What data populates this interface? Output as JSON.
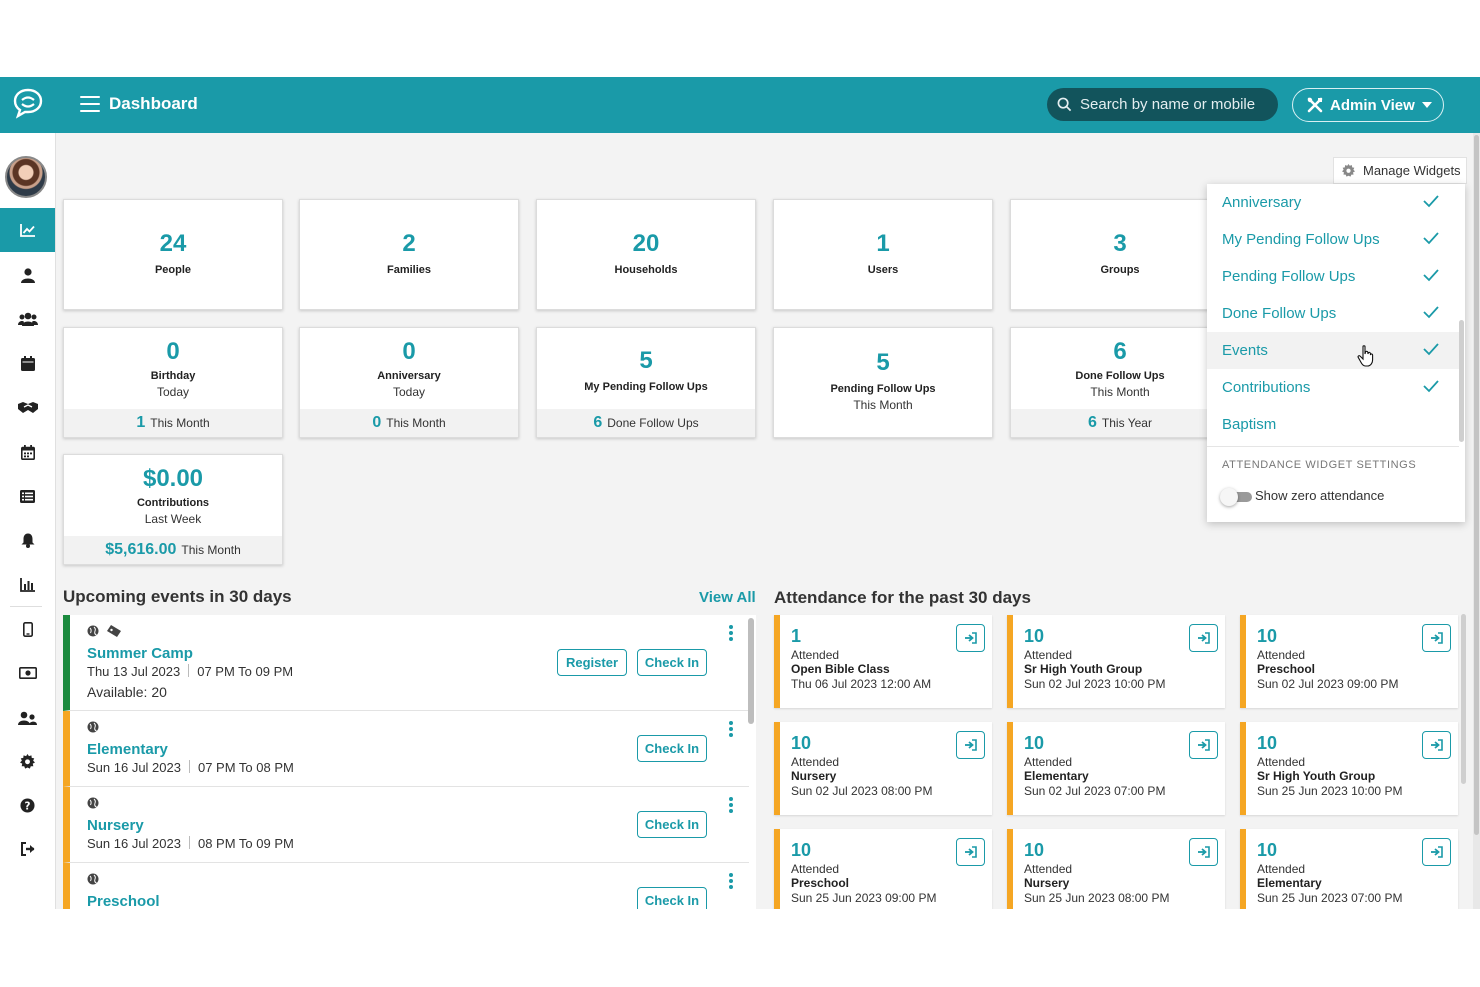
{
  "header": {
    "title": "Dashboard",
    "search_placeholder": "Search by name or mobile",
    "admin_view_label": "Admin View"
  },
  "colors": {
    "brand": "#1a9aa8",
    "accent": "#f5a623",
    "event_active": "#1b8a3e"
  },
  "sidebar": {
    "items": [
      {
        "name": "dashboard",
        "icon": "chart-icon",
        "active": true
      },
      {
        "name": "people",
        "icon": "person-icon"
      },
      {
        "name": "groups",
        "icon": "users-icon"
      },
      {
        "name": "events",
        "icon": "calendar-icon"
      },
      {
        "name": "follow-ups",
        "icon": "handshake-icon"
      },
      {
        "name": "schedule",
        "icon": "calendar-grid-icon"
      },
      {
        "name": "lists",
        "icon": "list-icon"
      },
      {
        "name": "notifications",
        "icon": "bell-icon"
      },
      {
        "name": "reports",
        "icon": "bar-chart-icon"
      },
      {
        "name": "mobile",
        "icon": "mobile-icon"
      },
      {
        "name": "contributions",
        "icon": "money-icon"
      },
      {
        "name": "users",
        "icon": "user-group-icon"
      },
      {
        "name": "settings",
        "icon": "gear-icon"
      },
      {
        "name": "help",
        "icon": "question-icon"
      },
      {
        "name": "logout",
        "icon": "logout-icon"
      }
    ]
  },
  "widgets": {
    "row1": [
      {
        "value": "24",
        "label": "People"
      },
      {
        "value": "2",
        "label": "Families"
      },
      {
        "value": "20",
        "label": "Households"
      },
      {
        "value": "1",
        "label": "Users"
      },
      {
        "value": "3",
        "label": "Groups"
      }
    ],
    "birthday": {
      "value": "0",
      "label": "Birthday",
      "sub": "Today",
      "foot_value": "1",
      "foot_label": "This Month"
    },
    "anniversary": {
      "value": "0",
      "label": "Anniversary",
      "sub": "Today",
      "foot_value": "0",
      "foot_label": "This Month"
    },
    "my_pending": {
      "value": "5",
      "label": "My Pending Follow Ups",
      "foot_value": "6",
      "foot_label": "Done Follow Ups"
    },
    "pending": {
      "value": "5",
      "label": "Pending Follow Ups",
      "sub": "This Month"
    },
    "done": {
      "value": "6",
      "label": "Done Follow Ups",
      "sub": "This Month",
      "foot_value": "6",
      "foot_label": "This Year"
    },
    "contributions": {
      "value": "$0.00",
      "label": "Contributions",
      "sub": "Last Week",
      "foot_value": "$5,616.00",
      "foot_label": "This Month"
    }
  },
  "manage_widgets": {
    "button_label": "Manage Widgets",
    "items": [
      {
        "label": "Anniversary",
        "checked": true
      },
      {
        "label": "My Pending Follow Ups",
        "checked": true
      },
      {
        "label": "Pending Follow Ups",
        "checked": true
      },
      {
        "label": "Done Follow Ups",
        "checked": true
      },
      {
        "label": "Events",
        "checked": true
      },
      {
        "label": "Contributions",
        "checked": true
      },
      {
        "label": "Baptism",
        "checked": false
      }
    ],
    "section_title": "ATTENDANCE WIDGET SETTINGS",
    "toggle_label": "Show zero attendance",
    "toggle_on": false
  },
  "events": {
    "title": "Upcoming events in 30 days",
    "view_all": "View All",
    "register_label": "Register",
    "checkin_label": "Check In",
    "items": [
      {
        "name": "Summer Camp",
        "date": "Thu 13 Jul  2023",
        "time": "07 PM To 09 PM",
        "available": "Available: 20"
      },
      {
        "name": "Elementary",
        "date": "Sun 16 Jul  2023",
        "time": "07 PM To 08 PM"
      },
      {
        "name": "Nursery",
        "date": "Sun 16 Jul  2023",
        "time": "08 PM To 09 PM"
      },
      {
        "name": "Preschool"
      }
    ]
  },
  "attendance": {
    "title": "Attendance for the past 30 days",
    "label": "Attended",
    "items": [
      {
        "count": "1",
        "name": "Open Bible Class",
        "date": "Thu 06 Jul 2023 12:00 AM"
      },
      {
        "count": "10",
        "name": "Sr High Youth Group",
        "date": "Sun 02 Jul 2023 10:00 PM"
      },
      {
        "count": "10",
        "name": "Preschool",
        "date": "Sun 02 Jul 2023 09:00 PM"
      },
      {
        "count": "10",
        "name": "Nursery",
        "date": "Sun 02 Jul 2023 08:00 PM"
      },
      {
        "count": "10",
        "name": "Elementary",
        "date": "Sun 02 Jul 2023 07:00 PM"
      },
      {
        "count": "10",
        "name": "Sr High Youth Group",
        "date": "Sun 25 Jun 2023 10:00 PM"
      },
      {
        "count": "10",
        "name": "Preschool",
        "date": "Sun 25 Jun 2023 09:00 PM"
      },
      {
        "count": "10",
        "name": "Nursery",
        "date": "Sun 25 Jun 2023 08:00 PM"
      },
      {
        "count": "10",
        "name": "Elementary",
        "date": "Sun 25 Jun 2023 07:00 PM"
      }
    ]
  }
}
